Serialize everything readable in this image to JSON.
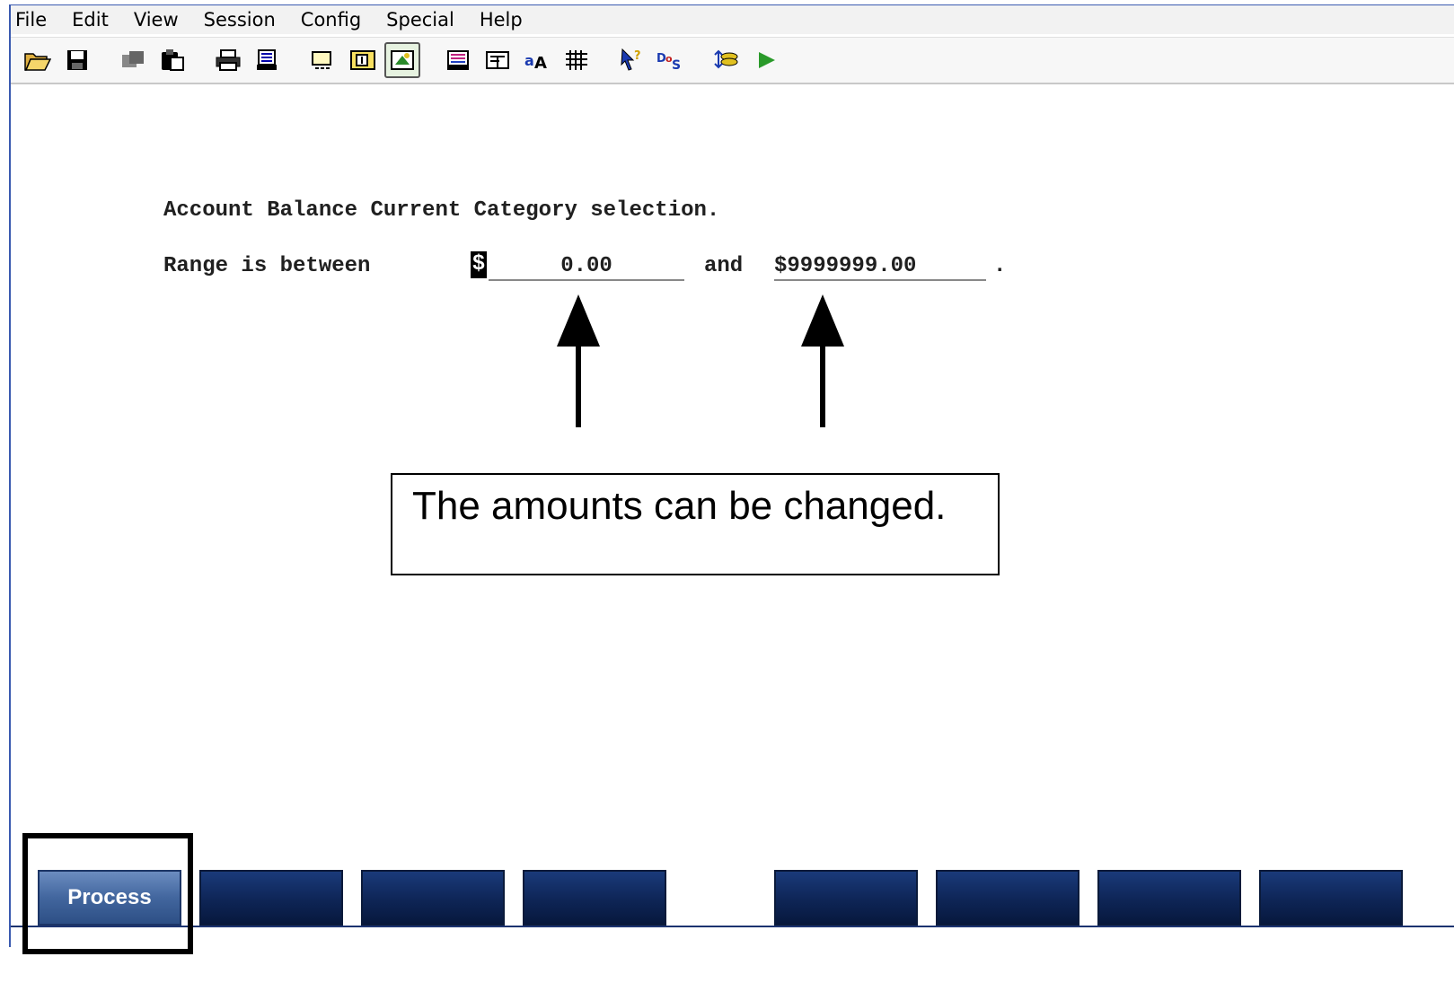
{
  "menu": [
    "File",
    "Edit",
    "View",
    "Session",
    "Config",
    "Special",
    "Help"
  ],
  "toolbar": {
    "icons": [
      "open-folder-icon",
      "save-icon",
      "copy-icon",
      "paste-icon",
      "print-icon",
      "print-screen-icon",
      "display-setup-icon",
      "keyboard-icon",
      "terminal-icon",
      "color-icon",
      "edit-field-icon",
      "font-icon",
      "grid-icon",
      "help-cursor-icon",
      "dos-icon",
      "transfer-icon",
      "play-icon"
    ]
  },
  "screen": {
    "line1": "Account Balance Current Category selection.",
    "line2_label": "Range is between ",
    "min_prefix": "$",
    "min_value": "0.00",
    "and_label": "and",
    "max_value": "$9999999.00",
    "period": "."
  },
  "callout": {
    "text": "The amounts can be changed."
  },
  "function_keys": [
    "Process",
    "",
    "",
    "",
    "",
    "",
    "",
    ""
  ],
  "colors": {
    "fkey_active": "#42669e",
    "fkey_inactive": "#0e2556",
    "window_border": "#3a5ab0"
  }
}
